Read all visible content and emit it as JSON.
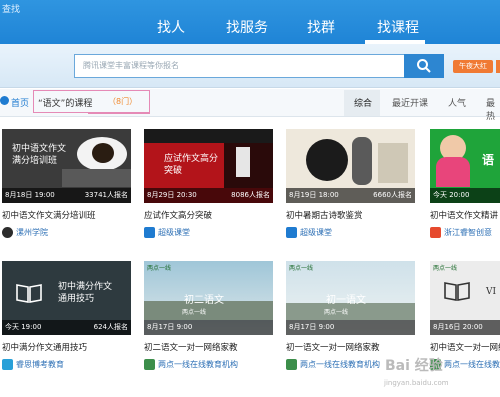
{
  "app": {
    "name": "查找"
  },
  "nav": {
    "items": [
      {
        "label": "找人"
      },
      {
        "label": "找服务"
      },
      {
        "label": "找群"
      },
      {
        "label": "找课程"
      }
    ]
  },
  "search": {
    "placeholder": "腾讯课堂丰富课程等你报名",
    "promo": "午夜大红"
  },
  "breadcrumb": {
    "home": "首页",
    "course": "“语文”的课程",
    "count": "（8门）"
  },
  "sort": {
    "tabs": [
      {
        "label": "综合"
      },
      {
        "label": "最近开课"
      },
      {
        "label": "人气"
      },
      {
        "label": "最热"
      }
    ]
  },
  "courses": [
    {
      "date": "8月18日 19:00",
      "enrol": "33741人报名",
      "title": "初中语文作文满分培训班",
      "org": "漯州学院",
      "cover": "初中语文作文满分培训班"
    },
    {
      "date": "8月29日 20:30",
      "enrol": "8086人报名",
      "title": "应试作文高分突破",
      "org": "超级课堂",
      "cover": "应试作文高分突破"
    },
    {
      "date": "8月19日 18:00",
      "enrol": "6660人报名",
      "title": "初中暑期古诗歌鉴赏",
      "org": "超级课堂",
      "cover": ""
    },
    {
      "date": "今天 20:00",
      "enrol": "",
      "title": "初中语文作文精讲",
      "org": "浙江睿智创意",
      "cover": "语"
    },
    {
      "date": "今天 19:00",
      "enrol": "624人报名",
      "title": "初中满分作文通用技巧",
      "org": "睿思博考教育",
      "cover": "初中满分作文通用技巧"
    },
    {
      "date": "8月17日 9:00",
      "enrol": "",
      "title": "初二语文一对一网络家教",
      "org": "两点一线在线教育机构",
      "cover": "初二语文",
      "sub": "两点一线",
      "tag": "两点一线"
    },
    {
      "date": "8月17日 9:00",
      "enrol": "",
      "title": "初一语文一对一网络家教",
      "org": "两点一线在线教育机构",
      "cover": "初一语文",
      "sub": "两点一线",
      "tag": "两点一线"
    },
    {
      "date": "8月16日 20:00",
      "enrol": "",
      "title": "初中语文一对一网络家教",
      "org": "两点一线在线教育机构",
      "cover": "VI",
      "tag": "两点一线"
    }
  ],
  "watermark": {
    "text": "Bai 经验",
    "url": "jingyan.baidu.com"
  }
}
